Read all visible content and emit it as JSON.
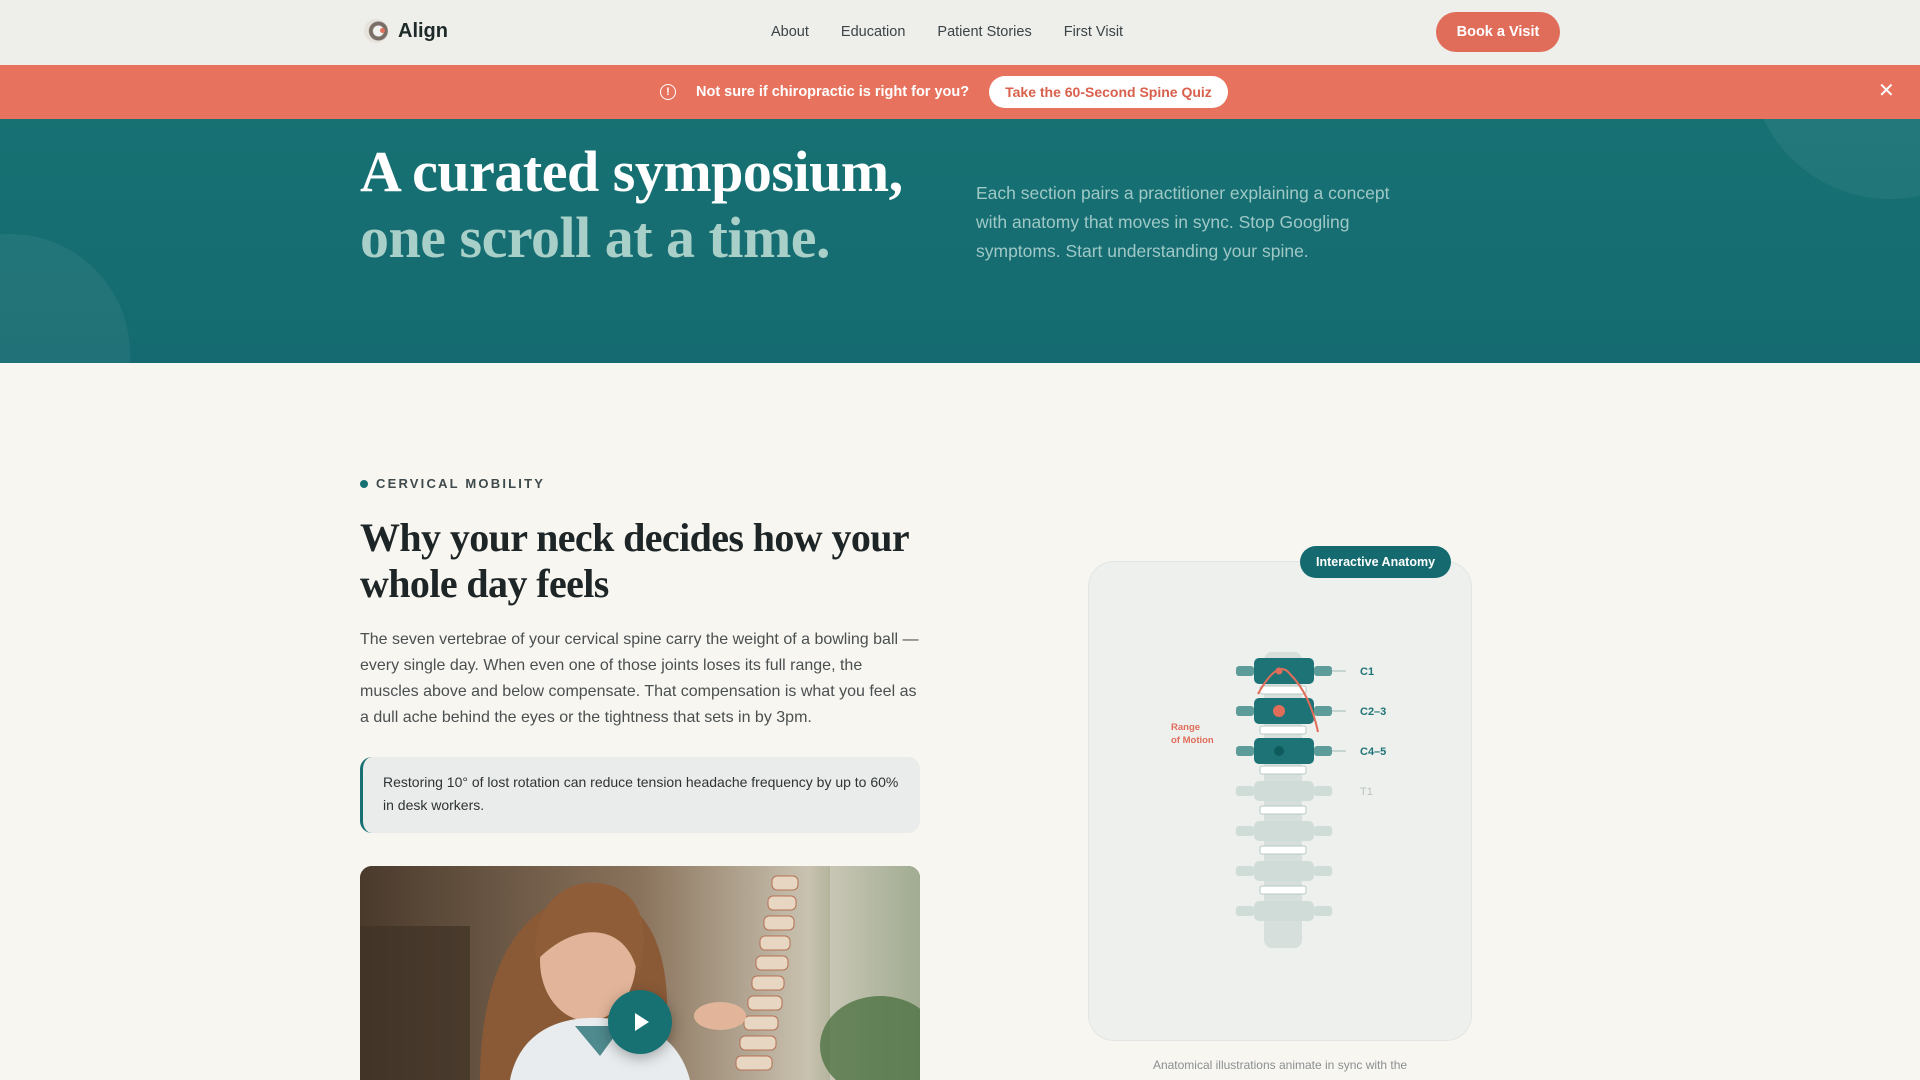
{
  "nav": {
    "brand": "Align",
    "links": [
      "About",
      "Education",
      "Patient Stories",
      "First Visit"
    ],
    "cta": "Book a Visit"
  },
  "banner": {
    "text": "Not sure if chiropractic is right for you?",
    "button": "Take the 60-Second Spine Quiz",
    "close_icon": "close-icon"
  },
  "hero": {
    "title_line1": "A curated symposium,",
    "title_line2": "one scroll at a time.",
    "description": "Each section pairs a practitioner explaining a concept with anatomy that moves in sync. Stop Googling symptoms. Start understanding your spine."
  },
  "section": {
    "eyebrow": "CERVICAL MOBILITY",
    "title": "Why your neck decides how your whole day feels",
    "body": "The seven vertebrae of your cervical spine carry the weight of a bowling ball — every single day. When even one of those joints loses its full range, the muscles above and below compensate. That compensation is what you feel as a dull ache behind the eyes or the tightness that sets in by 3pm.",
    "callout": "Restoring 10° of lost rotation can reduce tension headache frequency by up to 60% in desk workers."
  },
  "anatomy": {
    "badge": "Interactive Anatomy",
    "range_label_1": "Range",
    "range_label_2": "of Motion",
    "labels": [
      "C1",
      "C2–3",
      "C4–5",
      "T1"
    ],
    "caption": "Anatomical illustrations animate in sync with the"
  },
  "colors": {
    "teal": "#177173",
    "coral": "#e7735f",
    "cream": "#f8f6f1"
  }
}
